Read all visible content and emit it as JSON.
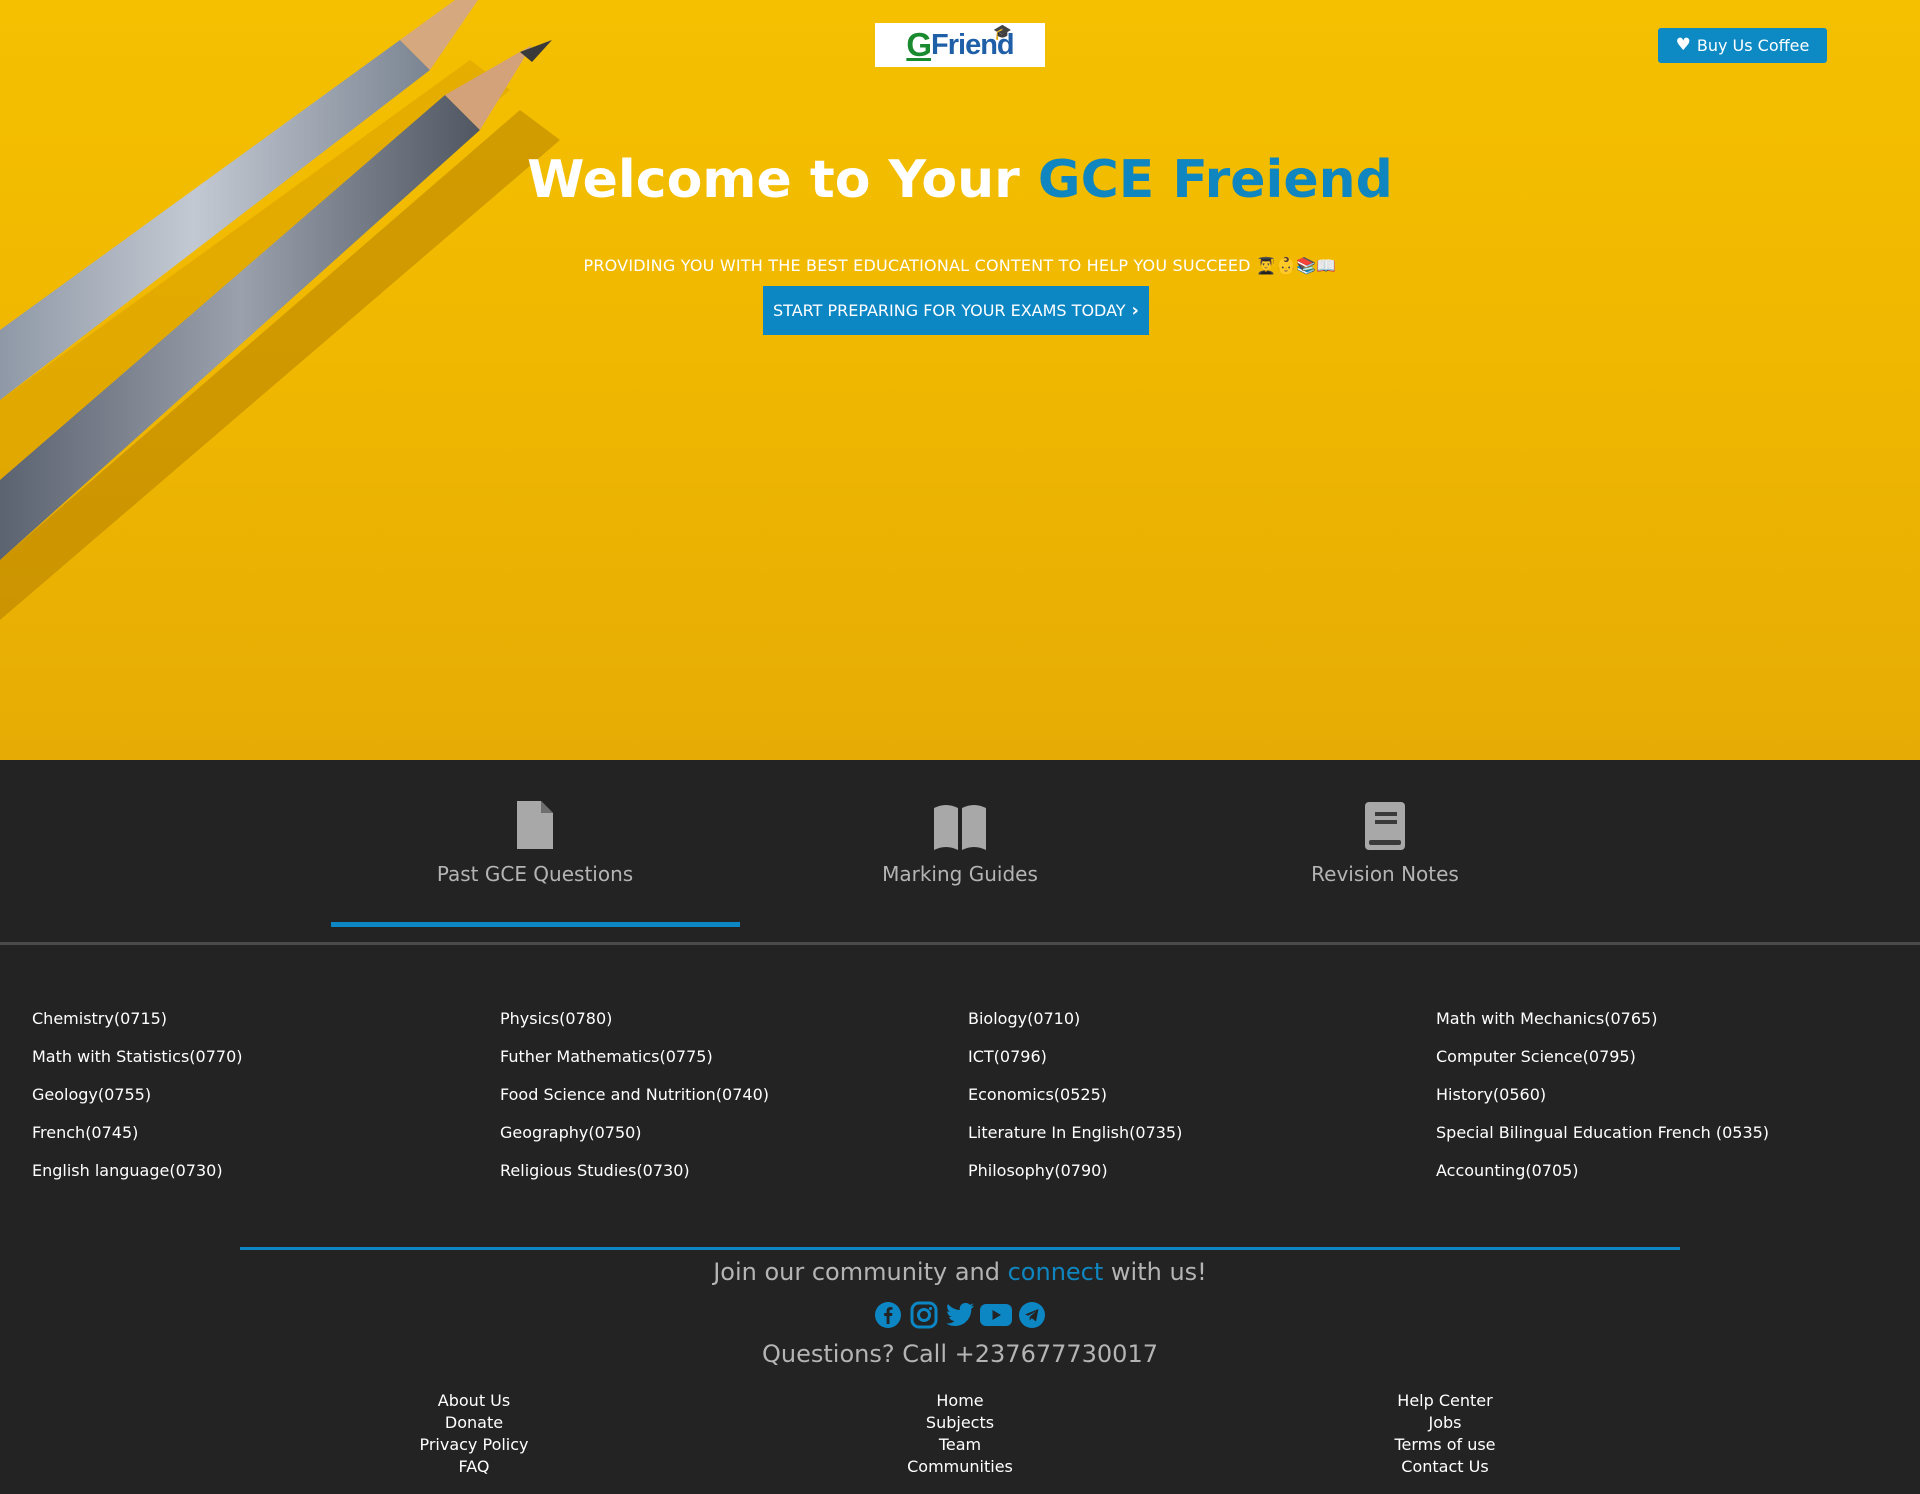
{
  "header": {
    "logo_text_g": "G",
    "logo_text_rest": "Friend",
    "coffee_button": "Buy Us Coffee"
  },
  "hero": {
    "title_part1": "Welcome to Your ",
    "title_accent": "GCE Freiend",
    "subtitle": "PROVIDING YOU WITH THE BEST EDUCATIONAL CONTENT TO HELP YOU SUCCEED 👨‍🎓👶📚📖",
    "cta_label": "START PREPARING FOR YOUR EXAMS TODAY"
  },
  "tabs": [
    {
      "label": "Past GCE Questions",
      "icon": "file-icon",
      "active": true
    },
    {
      "label": "Marking Guides",
      "icon": "open-book-icon",
      "active": false
    },
    {
      "label": "Revision Notes",
      "icon": "book-icon",
      "active": false
    }
  ],
  "subjects": {
    "col1": [
      "Chemistry(0715)",
      "Math with Statistics(0770)",
      "Geology(0755)",
      "French(0745)",
      "English language(0730)"
    ],
    "col2": [
      "Physics(0780)",
      "Futher Mathematics(0775)",
      "Food Science and Nutrition(0740)",
      "Geography(0750)",
      "Religious Studies(0730)"
    ],
    "col3": [
      "Biology(0710)",
      "ICT(0796)",
      "Economics(0525)",
      "Literature In English(0735)",
      "Philosophy(0790)"
    ],
    "col4": [
      "Math with Mechanics(0765)",
      "Computer Science(0795)",
      "History(0560)",
      "Special Bilingual Education French (0535)",
      "Accounting(0705)"
    ]
  },
  "footer": {
    "join_part1": "Join our community and ",
    "join_accent": "connect",
    "join_part2": " with us!",
    "socials": [
      "facebook-icon",
      "instagram-icon",
      "twitter-icon",
      "youtube-icon",
      "telegram-icon"
    ],
    "phone": "Questions? Call +237677730017",
    "col1": [
      "About Us",
      "Donate",
      "Privacy Policy",
      "FAQ"
    ],
    "col2": [
      "Home",
      "Subjects",
      "Team",
      "Communities"
    ],
    "col3": [
      "Help Center",
      "Jobs",
      "Terms of use",
      "Contact Us"
    ]
  },
  "colors": {
    "hero_yellow": "#f3bc00",
    "accent_blue": "#0d86c4",
    "dark_bg": "#232323",
    "muted_text": "#b4b4b4"
  }
}
